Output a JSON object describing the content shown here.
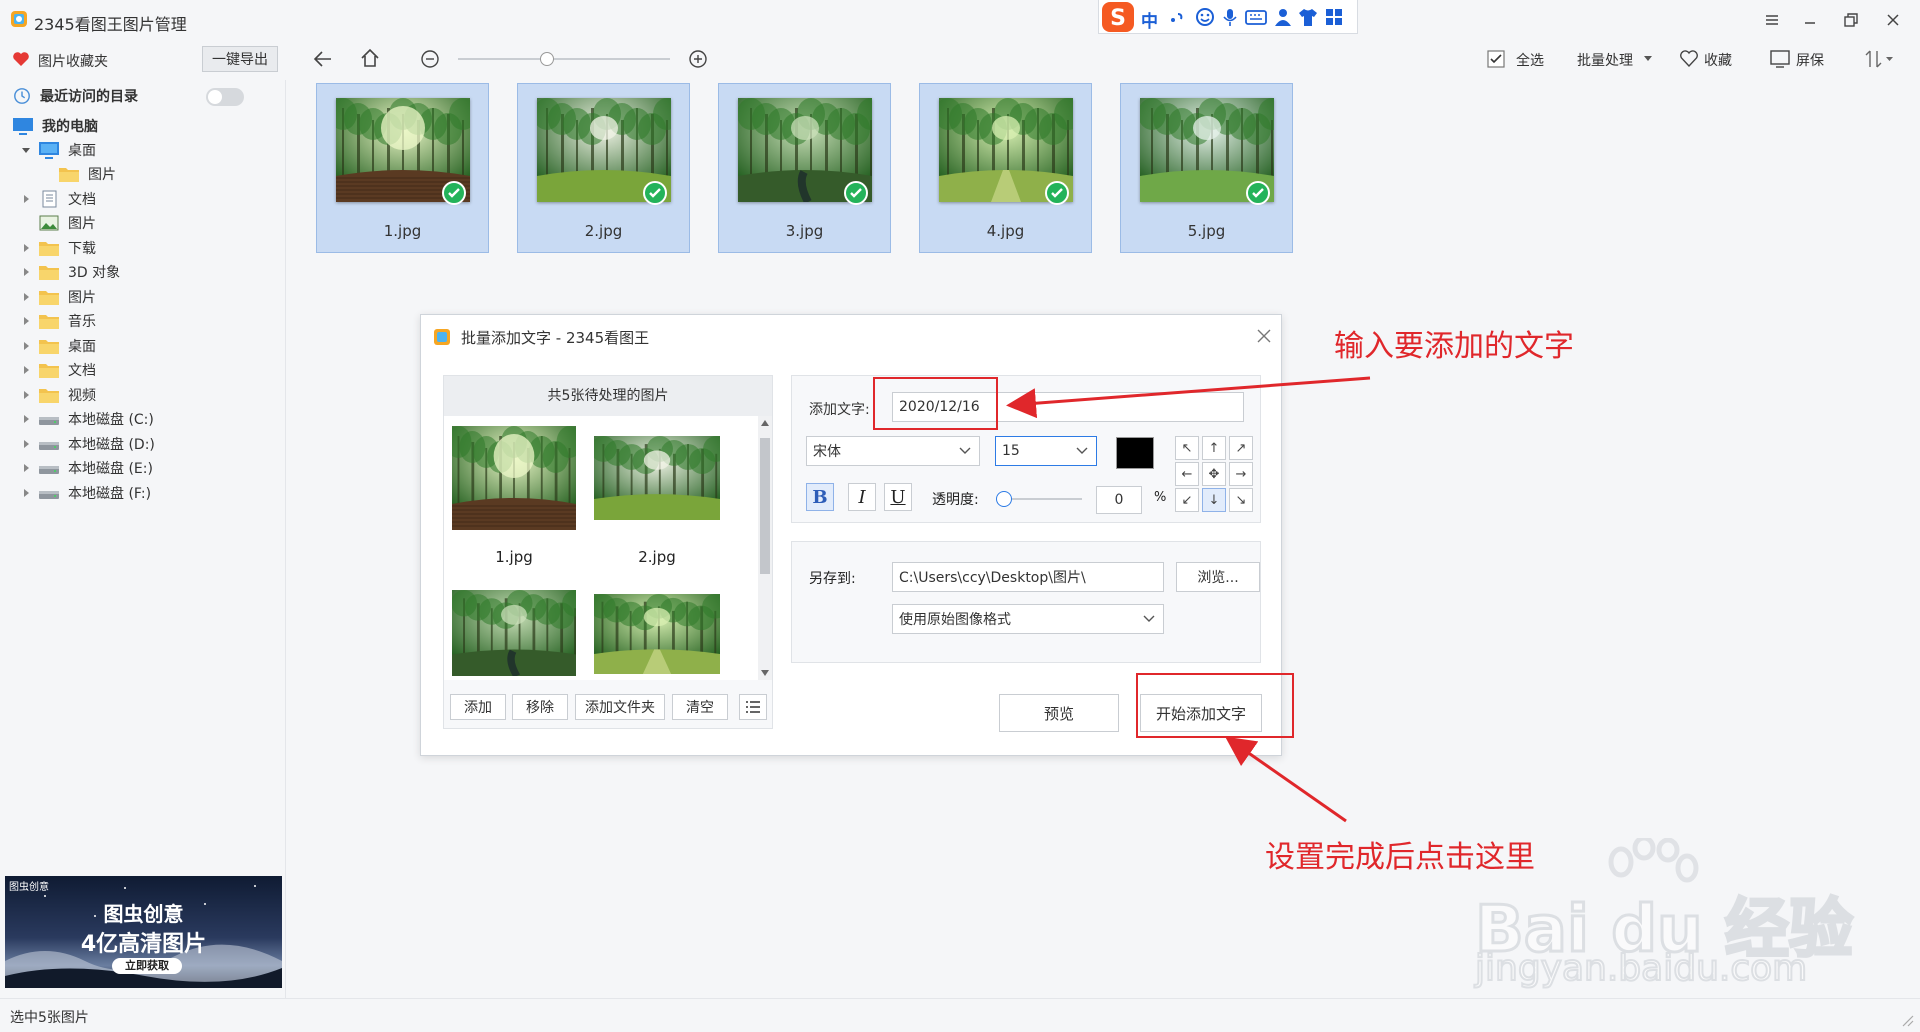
{
  "titlebar": {
    "app_title": "2345看图王图片管理",
    "ime": {
      "logo": "S",
      "mode": "中"
    }
  },
  "toolbar": {
    "favorites_label": "图片收藏夹",
    "export_label": "一键导出",
    "select_all_label": "全选",
    "batch_label": "批量处理",
    "collect_label": "收藏",
    "screen_label": "屏保",
    "zoom_fraction": 0.42
  },
  "sidebar": {
    "recent_label": "最近访问的目录",
    "computer_label": "我的电脑",
    "items": [
      {
        "label": "桌面",
        "icon": "desktop-icon"
      },
      {
        "label": "图片",
        "icon": "folder-icon"
      },
      {
        "label": "文档",
        "icon": "document-icon"
      },
      {
        "label": "图片",
        "icon": "pictures-icon"
      },
      {
        "label": "下载",
        "icon": "folder-icon"
      },
      {
        "label": "3D 对象",
        "icon": "folder-icon"
      },
      {
        "label": "图片",
        "icon": "folder-icon"
      },
      {
        "label": "音乐",
        "icon": "folder-icon"
      },
      {
        "label": "桌面",
        "icon": "folder-icon"
      },
      {
        "label": "文档",
        "icon": "folder-icon"
      },
      {
        "label": "视频",
        "icon": "folder-icon"
      },
      {
        "label": "本地磁盘 (C:)",
        "icon": "drive-icon"
      },
      {
        "label": "本地磁盘 (D:)",
        "icon": "drive-icon"
      },
      {
        "label": "本地磁盘 (E:)",
        "icon": "drive-icon"
      },
      {
        "label": "本地磁盘 (F:)",
        "icon": "drive-icon"
      }
    ],
    "ad": {
      "brand": "图虫创意",
      "line1": "图虫创意",
      "line2": "4亿高清图片",
      "cta": "立即获取"
    }
  },
  "thumbnails": [
    {
      "name": "1.jpg"
    },
    {
      "name": "2.jpg"
    },
    {
      "name": "3.jpg"
    },
    {
      "name": "4.jpg"
    },
    {
      "name": "5.jpg"
    }
  ],
  "dialog": {
    "title": "批量添加文字 - 2345看图王",
    "list_header": "共5张待处理的图片",
    "list_items": [
      "1.jpg",
      "2.jpg"
    ],
    "buttons": {
      "add": "添加",
      "remove": "移除",
      "add_folder": "添加文件夹",
      "clear": "清空"
    },
    "text_label": "添加文字:",
    "text_value": "2020/12/16",
    "font": "宋体",
    "size": "15",
    "text_color": "#000000",
    "opacity_label": "透明度:",
    "opacity_value": "0",
    "percent": "%",
    "bold": "B",
    "italic": "I",
    "underline": "U",
    "save_label": "另存到:",
    "save_path": "C:\\Users\\ccy\\Desktop\\图片\\",
    "browse_label": "浏览...",
    "format_option": "使用原始图像格式",
    "preview_label": "预览",
    "start_label": "开始添加文字"
  },
  "annotations": {
    "top": "输入要添加的文字",
    "bottom": "设置完成后点击这里"
  },
  "watermark": {
    "text": "Bai du 经验",
    "url": "jingyan.baidu.com"
  },
  "status": {
    "text": "选中5张图片"
  },
  "colors": {
    "accent": "#2d7be5",
    "selection": "#c8daf3",
    "annotation": "#e0272b"
  }
}
